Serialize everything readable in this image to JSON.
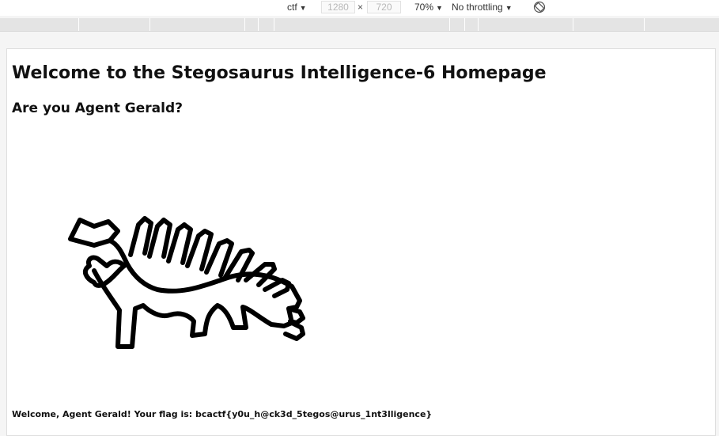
{
  "devtools": {
    "device": "ctf",
    "width_value": "1280",
    "times": "×",
    "height_value": "720",
    "zoom": "70%",
    "throttling": "No throttling",
    "rotate_icon": "rotate-icon"
  },
  "page": {
    "title": "Welcome to the Stegosaurus Intelligence-6 Homepage",
    "subtitle": "Are you Agent Gerald?",
    "image_icon": "stegosaurus-drawing",
    "flag_message": "Welcome, Agent Gerald! Your flag is: bcactf{y0u_h@ck3d_5tegos@urus_1nt3lligence}"
  }
}
